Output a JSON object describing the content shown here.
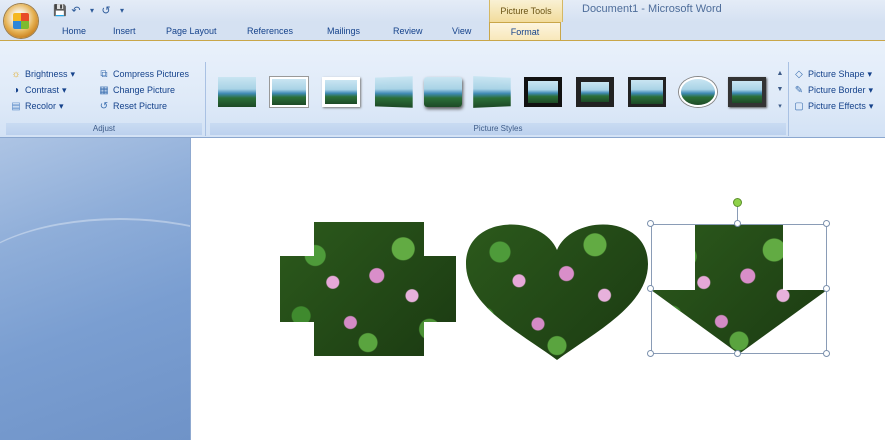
{
  "window": {
    "title": "Document1 - Microsoft Word",
    "context_group": "Picture Tools"
  },
  "quick_access": {
    "icons": [
      "save-icon",
      "undo-icon",
      "redo-icon",
      "customize-qat-icon"
    ]
  },
  "tabs": [
    {
      "label": "Home"
    },
    {
      "label": "Insert"
    },
    {
      "label": "Page Layout"
    },
    {
      "label": "References"
    },
    {
      "label": "Mailings"
    },
    {
      "label": "Review"
    },
    {
      "label": "View"
    },
    {
      "label": "Format",
      "active": true
    }
  ],
  "ribbon": {
    "adjust": {
      "label": "Adjust",
      "commands": [
        {
          "label": "Brightness",
          "icon": "brightness-icon"
        },
        {
          "label": "Contrast",
          "icon": "contrast-icon"
        },
        {
          "label": "Recolor",
          "icon": "recolor-icon"
        },
        {
          "label": "Compress Pictures",
          "icon": "compress-pictures-icon"
        },
        {
          "label": "Change Picture",
          "icon": "change-picture-icon"
        },
        {
          "label": "Reset Picture",
          "icon": "reset-picture-icon"
        }
      ]
    },
    "picture_styles": {
      "label": "Picture Styles",
      "thumbnail_count": 11,
      "commands": [
        {
          "label": "Picture Shape",
          "icon": "picture-shape-icon"
        },
        {
          "label": "Picture Border",
          "icon": "picture-border-icon"
        },
        {
          "label": "Picture Effects",
          "icon": "picture-effects-icon"
        }
      ]
    }
  },
  "document": {
    "shapes": [
      {
        "name": "plus-shaped-picture",
        "shape": "plus"
      },
      {
        "name": "heart-shaped-picture",
        "shape": "heart"
      },
      {
        "name": "arrow-shaped-picture",
        "shape": "down-arrow",
        "selected": true
      }
    ]
  },
  "colors": {
    "ribbon_bg": "#dfeaf8",
    "text": "#15428b",
    "context_tab": "#f2dc9c",
    "side_pane": "#7a9ed1"
  }
}
